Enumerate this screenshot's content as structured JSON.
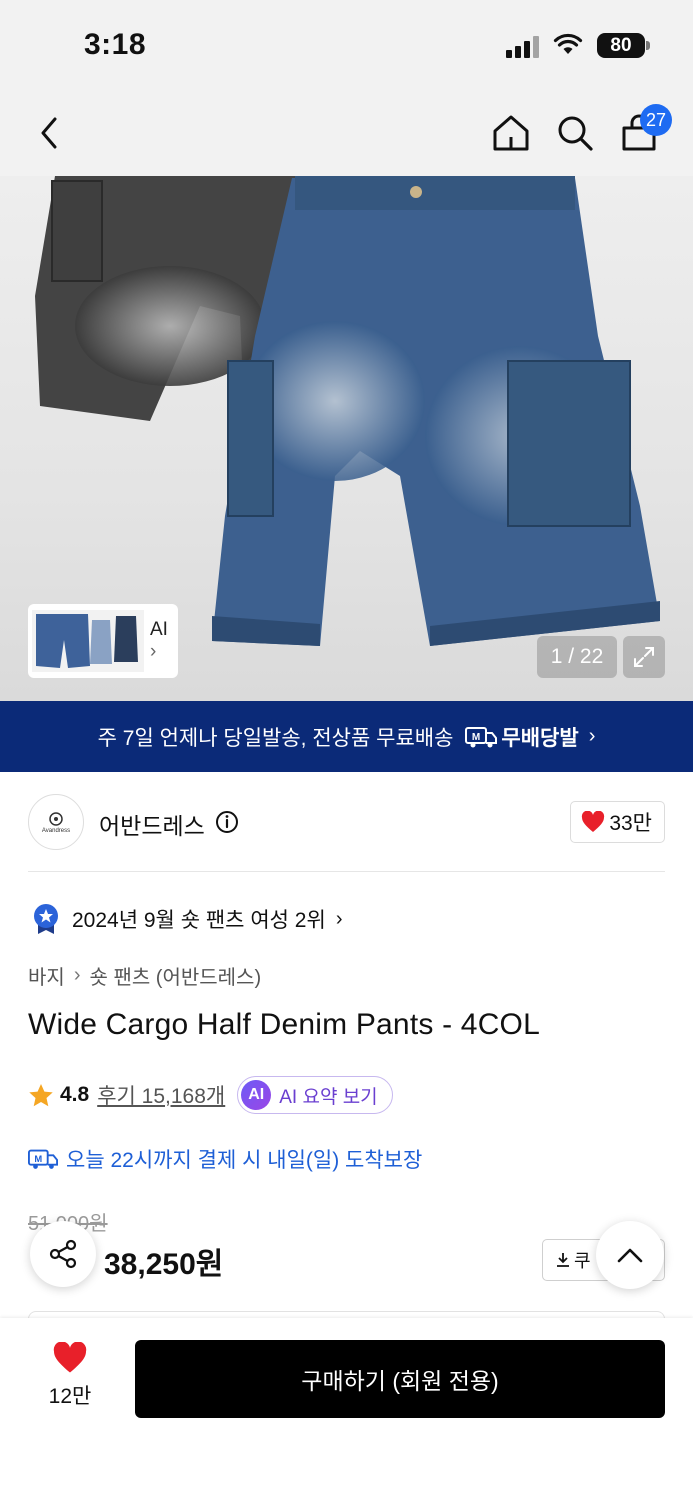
{
  "status_bar": {
    "time": "3:18",
    "battery": "80"
  },
  "nav": {
    "cart_count": "27"
  },
  "gallery": {
    "ai_thumb_label": "AI",
    "page_counter": "1 / 22",
    "current_image": 1,
    "total_images": 22
  },
  "shipping_banner": {
    "text": "주 7일 언제나 당일발송, 전상품 무료배송",
    "badge_label": "무배당발"
  },
  "brand": {
    "name": "어반드레스",
    "logo_text": "Avandress",
    "likes": "33만"
  },
  "ranking": {
    "label": "2024년 9월 숏 팬츠 여성 2위"
  },
  "breadcrumb": {
    "category": "바지",
    "subcategory": "숏 팬츠 (어반드레스)"
  },
  "product": {
    "title": "Wide Cargo Half Denim Pants - 4COL",
    "rating": "4.8",
    "reviews_label": "후기 15,168개",
    "ai_badge": "AI",
    "ai_summary_label": "AI 요약 보기",
    "delivery_text": "오늘 22시까지 결제 시 내일(일) 도착보장",
    "original_price": "51,000원",
    "price": "38,250원",
    "coupon_label": "쿠"
  },
  "bottom_bar": {
    "wish_count": "12만",
    "buy_label": "구매하기 (회원 전용)"
  },
  "colors": {
    "accent_blue": "#1e6bf2",
    "banner_navy": "#0b2a78",
    "heart_red": "#e8202a",
    "star_orange": "#f5a623",
    "ai_purple": "#6a3fd0"
  }
}
